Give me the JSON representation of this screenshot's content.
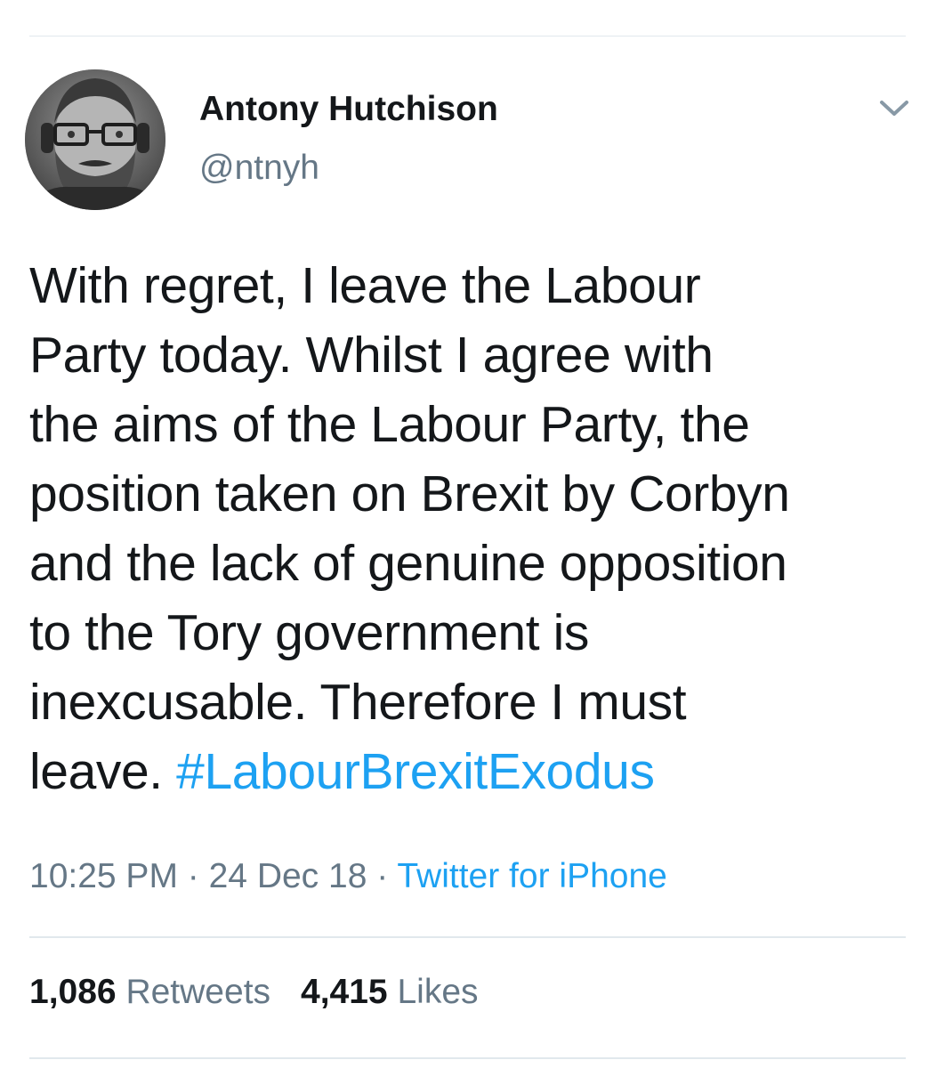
{
  "author": {
    "name": "Antony Hutchison",
    "handle": "@ntnyh"
  },
  "tweet": {
    "lines": [
      "With regret, I leave the Labour",
      "Party today. Whilst I agree with",
      "the aims of the Labour Party, the",
      "position taken on Brexit by Corbyn",
      "and the lack of genuine opposition",
      "to the Tory government is",
      "inexcusable. Therefore I must",
      "leave. "
    ],
    "hashtag": "#LabourBrexitExodus"
  },
  "meta": {
    "time": "10:25 PM",
    "separator_1": " · ",
    "date": "24 Dec 18",
    "separator_2": " · ",
    "source": "Twitter for iPhone"
  },
  "stats": {
    "retweets_count": "1,086",
    "retweets_label": "Retweets",
    "likes_count": "4,415",
    "likes_label": "Likes"
  },
  "colors": {
    "link": "#1da1f2",
    "secondary_text": "#657786",
    "primary_text": "#14171a",
    "divider": "#e1e8ed"
  },
  "icons": {
    "menu": "chevron-down-icon"
  }
}
